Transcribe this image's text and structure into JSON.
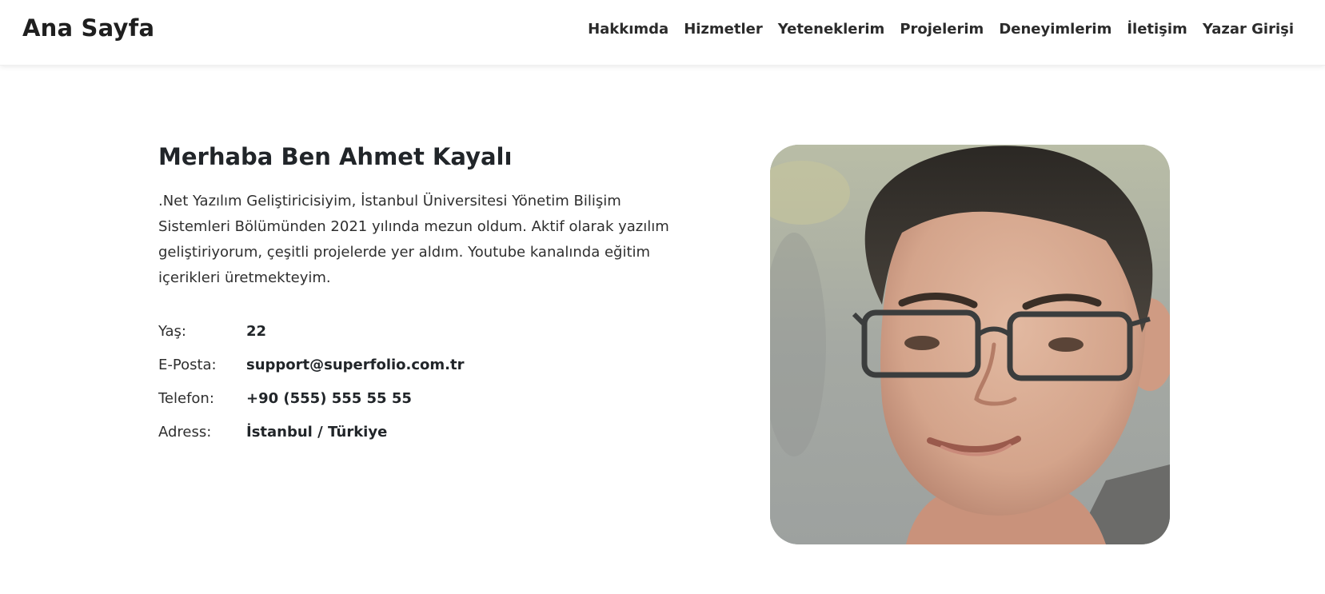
{
  "navbar": {
    "brand": "Ana Sayfa",
    "links": [
      {
        "label": "Hakkımda"
      },
      {
        "label": "Hizmetler"
      },
      {
        "label": "Yeteneklerim"
      },
      {
        "label": "Projelerim"
      },
      {
        "label": "Deneyimlerim"
      },
      {
        "label": "İletişim"
      },
      {
        "label": "Yazar Girişi"
      }
    ]
  },
  "about": {
    "title": "Merhaba Ben Ahmet Kayalı",
    "text": ".Net Yazılım Geliştiricisiyim, İstanbul Üniversitesi Yönetim Bilişim Sistemleri Bölümünden 2021 yılında mezun oldum. Aktif olarak yazılım geliştiriyorum, çeşitli projelerde yer aldım. Youtube kanalında eğitim içerikleri üretmekteyim.",
    "info": [
      {
        "label": "Yaş:",
        "value": "22"
      },
      {
        "label": "E-Posta:",
        "value": "support@superfolio.com.tr"
      },
      {
        "label": "Telefon:",
        "value": "+90 (555) 555 55 55"
      },
      {
        "label": "Adress:",
        "value": "İstanbul / Türkiye"
      }
    ]
  },
  "colors": {
    "background": "#ffffff",
    "text": "#212529"
  }
}
